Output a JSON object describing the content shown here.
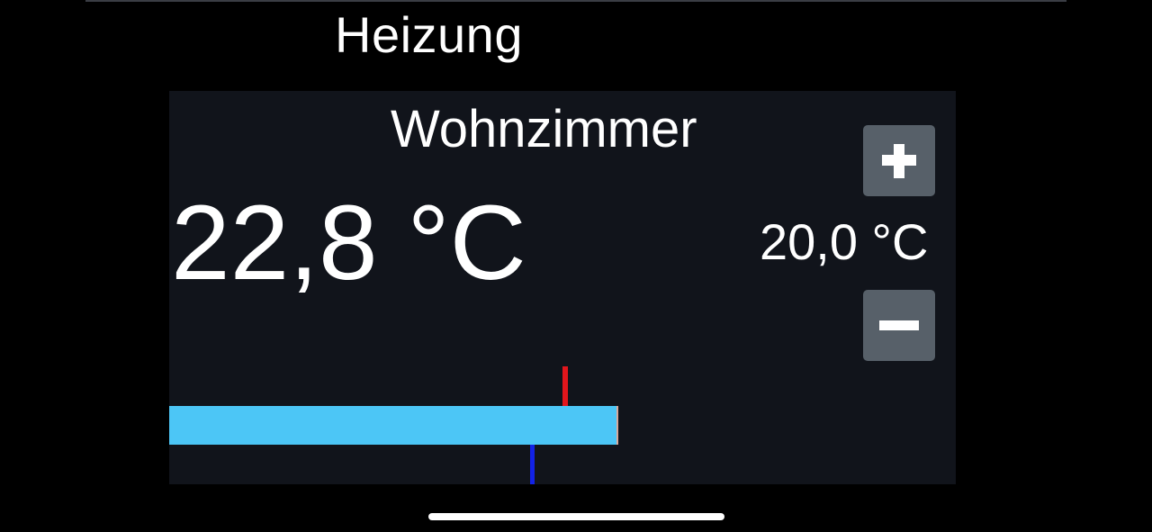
{
  "header": {
    "title": "Heizung"
  },
  "thermostat": {
    "room_name": "Wohnzimmer",
    "current_temperature": "22,8 °C",
    "setpoint_temperature": "20,0 °C",
    "plus_icon": "plus-icon",
    "minus_icon": "minus-icon",
    "bar": {
      "fill_fraction": 0.571,
      "red_marker_fraction": 0.503,
      "blue_marker_fraction": 0.461
    }
  },
  "colors": {
    "background": "#000000",
    "panel": "#11141b",
    "button": "#576069",
    "bar_fill": "#4cc6f6",
    "red_marker": "#e3161c",
    "blue_marker": "#1222e6",
    "text": "#ffffff"
  }
}
